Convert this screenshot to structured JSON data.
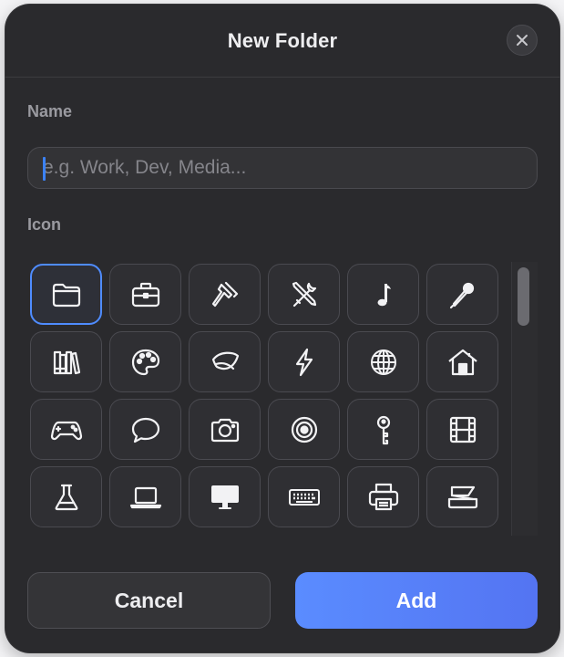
{
  "dialog": {
    "title": "New Folder",
    "close_icon": "close-icon"
  },
  "name_section": {
    "label": "Name",
    "placeholder": "e.g. Work, Dev, Media...",
    "value": ""
  },
  "icon_section": {
    "label": "Icon",
    "selected_index": 0,
    "icons": [
      "folder-icon",
      "briefcase-icon",
      "hammer-icon",
      "tools-icon",
      "music-note-icon",
      "microphone-icon",
      "books-icon",
      "palette-icon",
      "leaf-icon",
      "lightning-icon",
      "globe-icon",
      "house-icon",
      "gamepad-icon",
      "speech-bubble-icon",
      "camera-icon",
      "target-icon",
      "key-icon",
      "film-icon",
      "flask-icon",
      "laptop-icon",
      "desktop-icon",
      "keyboard-icon",
      "printer-icon",
      "scanner-icon"
    ]
  },
  "actions": {
    "cancel_label": "Cancel",
    "add_label": "Add"
  },
  "colors": {
    "accent": "#4f8cff",
    "dialog_background": "#2a2a2d"
  }
}
